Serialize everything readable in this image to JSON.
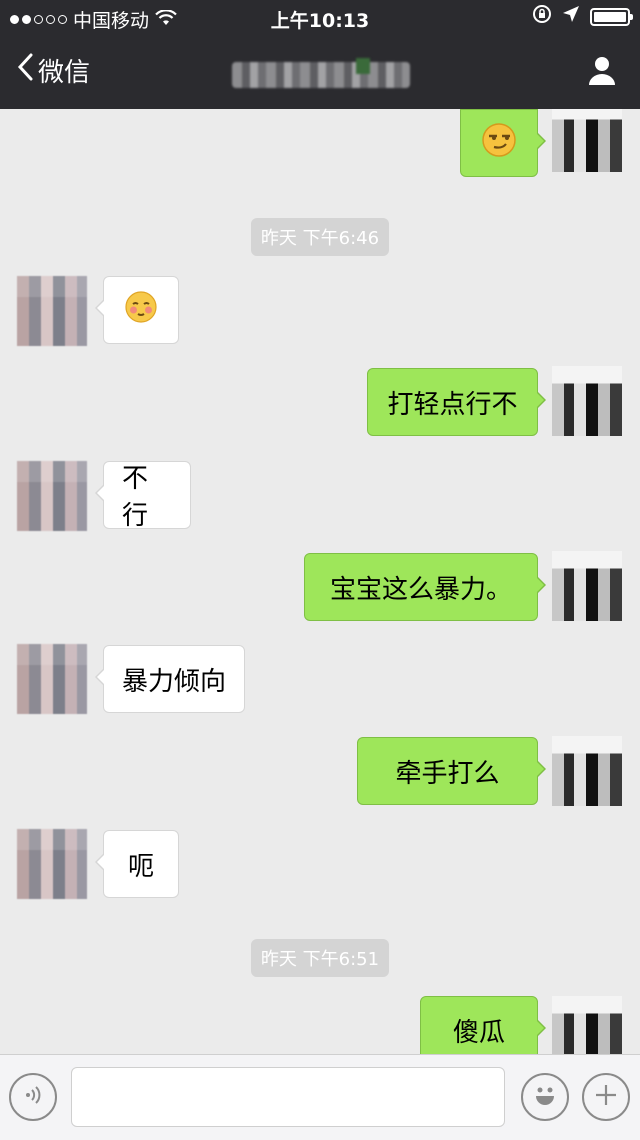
{
  "status_bar": {
    "carrier": "中国移动",
    "time": "上午10:13",
    "signal_dots_filled": 2,
    "signal_dots_total": 5
  },
  "nav": {
    "back_label": "微信"
  },
  "messages": [
    {
      "side": "out",
      "kind": "emoji",
      "icon": "smirk-emoji-icon"
    },
    {
      "side": "time",
      "text": "昨天 下午6:46"
    },
    {
      "side": "in",
      "kind": "emoji",
      "icon": "blushing-emoji-icon"
    },
    {
      "side": "out",
      "text": "打轻点行不"
    },
    {
      "side": "in",
      "text": "不行"
    },
    {
      "side": "out",
      "text": "宝宝这么暴力。"
    },
    {
      "side": "in",
      "text": "暴力倾向"
    },
    {
      "side": "out",
      "text": "牵手打么"
    },
    {
      "side": "in",
      "text": "呃"
    },
    {
      "side": "time",
      "text": "昨天 下午6:51"
    },
    {
      "side": "out",
      "text": "傻瓜"
    }
  ],
  "colors": {
    "header_bg": "#2b2b2f",
    "chat_bg": "#ebebeb",
    "outgoing_bubble": "#9ee65a",
    "incoming_bubble": "#ffffff"
  },
  "input_bar": {
    "text_value": ""
  }
}
